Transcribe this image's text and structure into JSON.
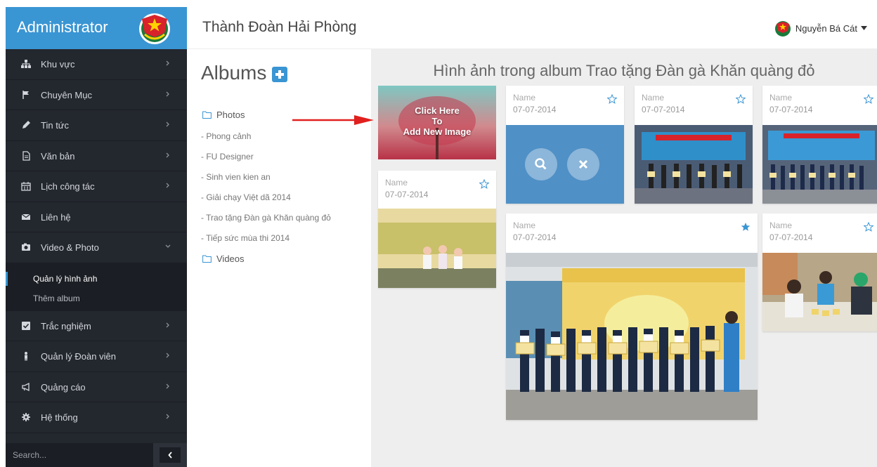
{
  "sidebar": {
    "brand": "Administrator",
    "items": [
      {
        "label": "Khu vực",
        "icon": "sitemap-icon"
      },
      {
        "label": "Chuyên Mục",
        "icon": "flag-icon"
      },
      {
        "label": "Tin tức",
        "icon": "pencil-icon"
      },
      {
        "label": "Văn bản",
        "icon": "document-icon"
      },
      {
        "label": "Lịch công tác",
        "icon": "calendar-icon"
      },
      {
        "label": "Liên hệ",
        "icon": "envelope-icon"
      },
      {
        "label": "Video & Photo",
        "icon": "camera-icon"
      },
      {
        "label": "Trắc nghiệm",
        "icon": "checkbox-icon"
      },
      {
        "label": "Quản lý Đoàn viên",
        "icon": "user-icon"
      },
      {
        "label": "Quảng cáo",
        "icon": "bullhorn-icon"
      },
      {
        "label": "Hệ thống",
        "icon": "gear-icon"
      }
    ],
    "submenu": [
      {
        "label": "Quản lý hình ảnh",
        "active": true
      },
      {
        "label": "Thêm album",
        "active": false
      }
    ],
    "search_placeholder": "Search..."
  },
  "header": {
    "title": "Thành Đoàn Hải Phòng",
    "user_name": "Nguyễn Bá Cát"
  },
  "albums": {
    "title": "Albums",
    "folders": [
      {
        "label": "Photos",
        "children": [
          "- Phong cảnh",
          "- FU Designer",
          "- Sinh vien kien an",
          "- Giải chạy Việt dã 2014",
          "- Trao tặng Đàn gà Khăn quàng đỏ",
          "- Tiếp sức mùa thi 2014"
        ]
      },
      {
        "label": "Videos",
        "children": []
      }
    ]
  },
  "gallery": {
    "title": "Hình ảnh trong album Trao tặng Đàn gà Khăn quàng đỏ",
    "add_image_text": "Click Here To Add New Image",
    "cards": [
      {
        "name": "Name",
        "date": "07-07-2014",
        "starred": false
      },
      {
        "name": "Name",
        "date": "07-07-2014",
        "starred": false
      },
      {
        "name": "Name",
        "date": "07-07-2014",
        "starred": false
      },
      {
        "name": "Name",
        "date": "07-07-2014",
        "starred": false
      },
      {
        "name": "Name",
        "date": "07-07-2014",
        "starred": true
      },
      {
        "name": "Name",
        "date": "07-07-2014",
        "starred": false
      }
    ]
  },
  "colors": {
    "accent": "#3a95d3",
    "sidebar_bg": "#23272e",
    "gallery_bg": "#eeeeee",
    "arrow": "#e0201e"
  }
}
